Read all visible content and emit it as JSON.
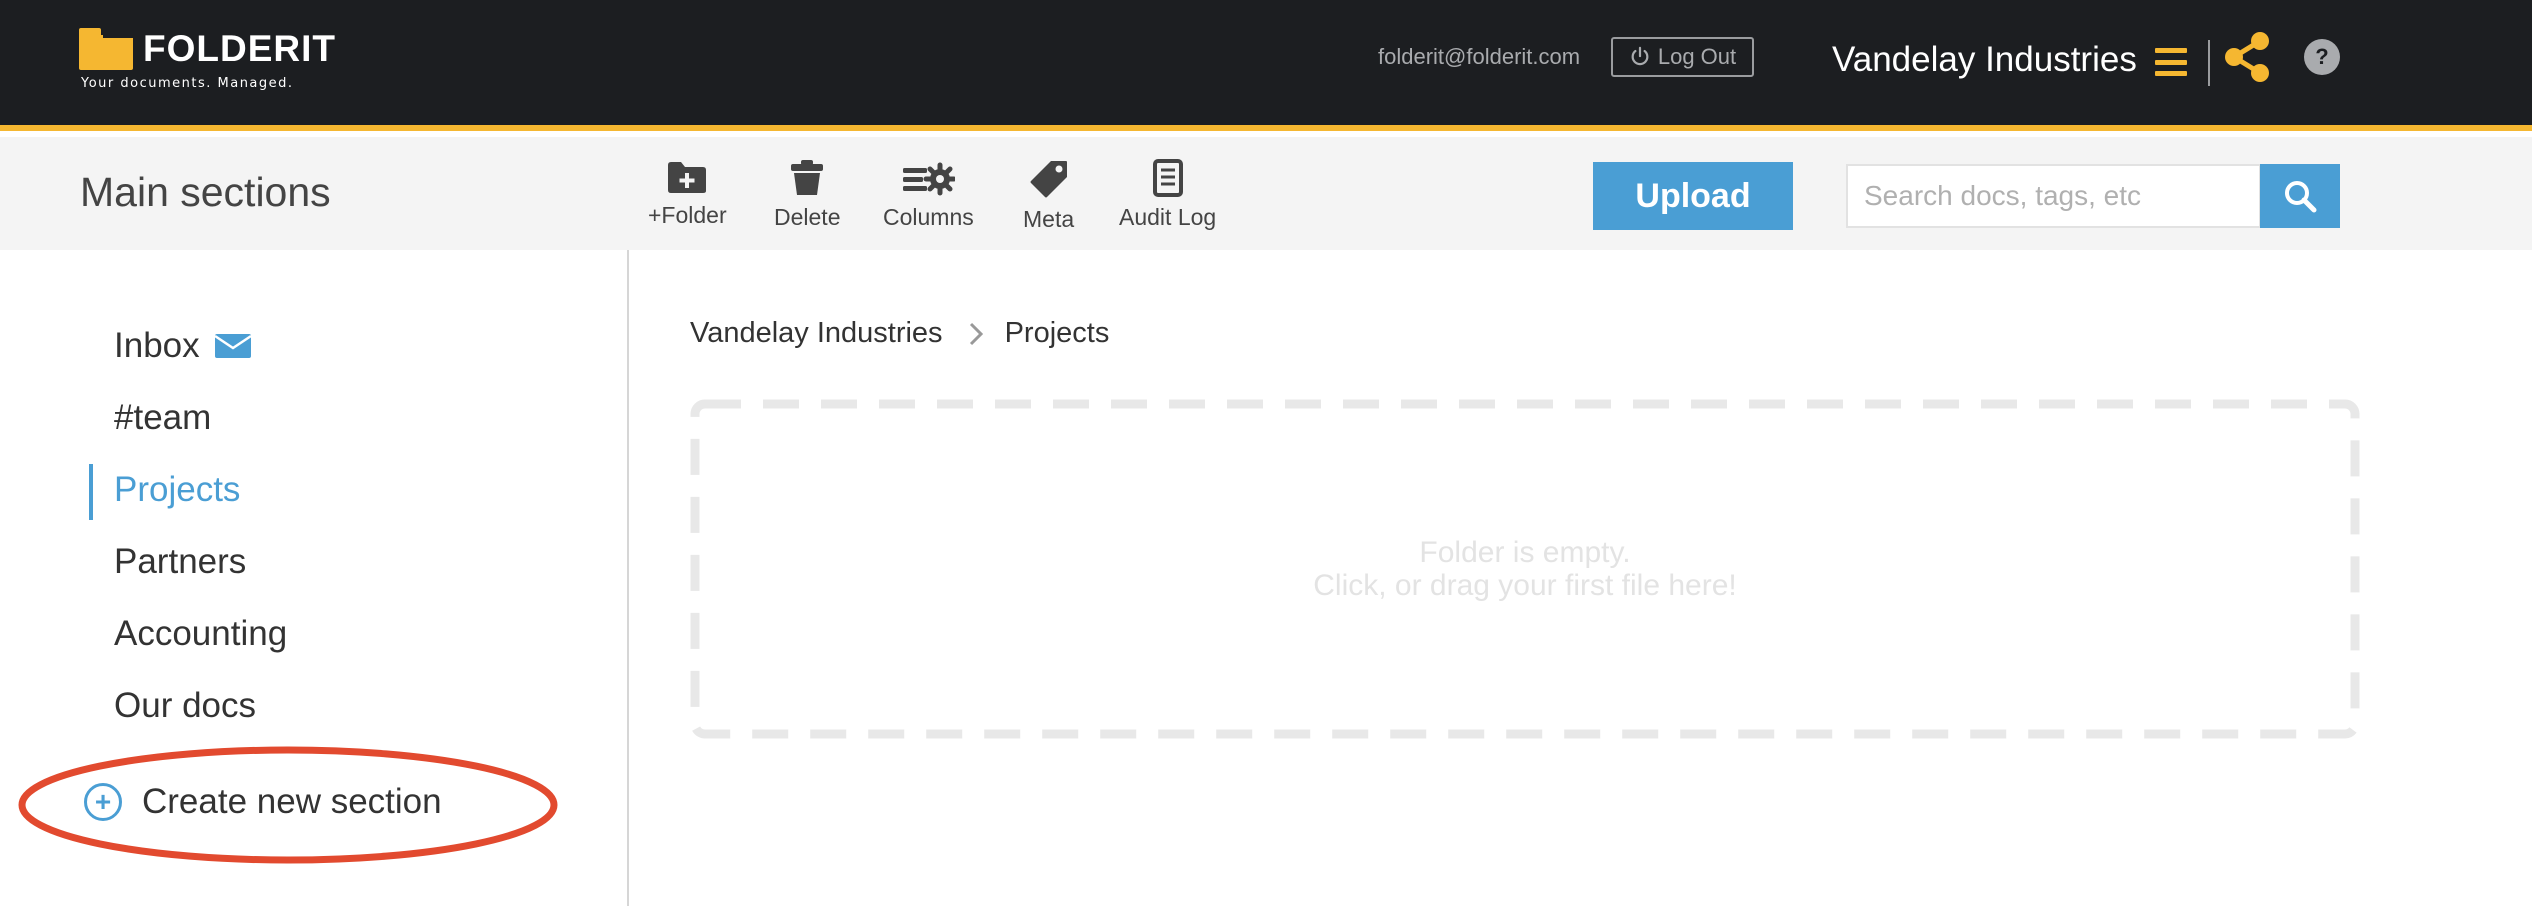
{
  "app": {
    "name": "FOLDERIT",
    "tagline": "Your documents. Managed.",
    "brand_color": "#f5b731",
    "accent_color": "#4a9ed4"
  },
  "header": {
    "user_email": "folderit@folderit.com",
    "logout_label": "Log Out",
    "logout_icon": "power-icon",
    "company_name": "Vandelay Industries",
    "menu_icon": "hamburger-icon",
    "share_icon": "share-icon",
    "help_label": "?"
  },
  "toolbar": {
    "section_title": "Main sections",
    "tools": [
      {
        "label": "+Folder",
        "icon": "folder-plus-icon"
      },
      {
        "label": "Delete",
        "icon": "trash-icon"
      },
      {
        "label": "Columns",
        "icon": "columns-settings-icon"
      },
      {
        "label": "Meta",
        "icon": "tag-icon"
      },
      {
        "label": "Audit Log",
        "icon": "document-icon"
      }
    ],
    "upload_label": "Upload",
    "search_placeholder": "Search docs, tags, etc",
    "search_icon": "search-icon"
  },
  "sidebar": {
    "items": [
      {
        "label": "Inbox",
        "icon": "envelope-icon"
      },
      {
        "label": "#team"
      },
      {
        "label": "Projects",
        "active": true
      },
      {
        "label": "Partners"
      },
      {
        "label": "Accounting"
      },
      {
        "label": "Our docs"
      }
    ],
    "create_label": "Create new section",
    "create_icon": "plus-circle-icon",
    "annotation_color": "#e24a2f"
  },
  "main": {
    "breadcrumb": [
      "Vandelay Industries",
      "Projects"
    ],
    "empty_line1": "Folder is empty.",
    "empty_line2": "Click, or drag your first file here!"
  }
}
